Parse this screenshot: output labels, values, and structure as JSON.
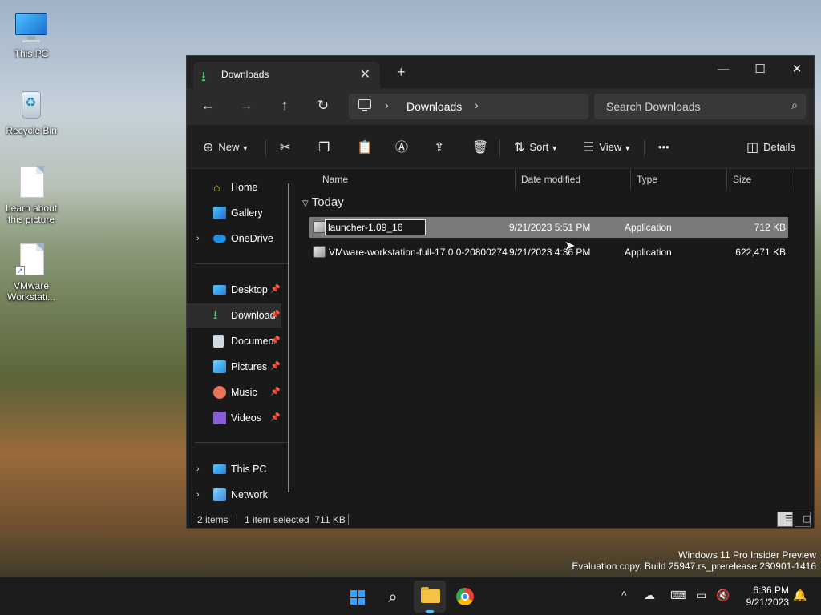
{
  "desktop": {
    "icons": [
      {
        "label": "This PC"
      },
      {
        "label": "Recycle Bin"
      },
      {
        "label": "Learn about this picture"
      },
      {
        "label": "VMware Workstati..."
      }
    ],
    "watermark": {
      "line1": "Windows 11 Pro Insider Preview",
      "line2": "Evaluation copy. Build 25947.rs_prerelease.230901-1416"
    }
  },
  "window": {
    "tab": {
      "label": "Downloads",
      "icon": "download-icon"
    },
    "controls": {
      "min": "—",
      "max": "☐",
      "close": "✕"
    },
    "address": {
      "crumb": "Downloads"
    },
    "search": {
      "placeholder": "Search Downloads"
    },
    "toolbar": {
      "new_label": "New",
      "sort_label": "Sort",
      "view_label": "View",
      "more_label": "•••",
      "details_label": "Details"
    },
    "nav": {
      "items": [
        {
          "label": "Home",
          "icon": "home-icon"
        },
        {
          "label": "Gallery",
          "icon": "gallery-icon"
        },
        {
          "label": "OneDrive",
          "icon": "cloud-icon"
        },
        {
          "label": "Desktop",
          "icon": "desktop-icon"
        },
        {
          "label": "Downloads",
          "icon": "download-icon"
        },
        {
          "label": "Documents",
          "icon": "document-icon"
        },
        {
          "label": "Pictures",
          "icon": "pictures-icon"
        },
        {
          "label": "Music",
          "icon": "music-icon"
        },
        {
          "label": "Videos",
          "icon": "videos-icon"
        },
        {
          "label": "This PC",
          "icon": "pc-icon"
        },
        {
          "label": "Network",
          "icon": "network-icon"
        }
      ]
    },
    "columns": [
      "Name",
      "Date modified",
      "Type",
      "Size"
    ],
    "group": "Today",
    "files": [
      {
        "name": "launcher-1.09_16",
        "date": "9/21/2023 5:51 PM",
        "type": "Application",
        "size": "712 KB",
        "selected": true
      },
      {
        "name": "VMware-workstation-full-17.0.0-20800274",
        "date": "9/21/2023 4:36 PM",
        "type": "Application",
        "size": "622,471 KB",
        "selected": false
      }
    ],
    "status": {
      "count": "2 items",
      "selection": "1 item selected  711 KB"
    }
  },
  "taskbar": {
    "clock_time": "6:36 PM",
    "clock_date": "9/21/2023"
  },
  "colors": {
    "accent": "#4cc2ff",
    "window_bg": "#191919",
    "selected_row": "#7a7a7a"
  }
}
